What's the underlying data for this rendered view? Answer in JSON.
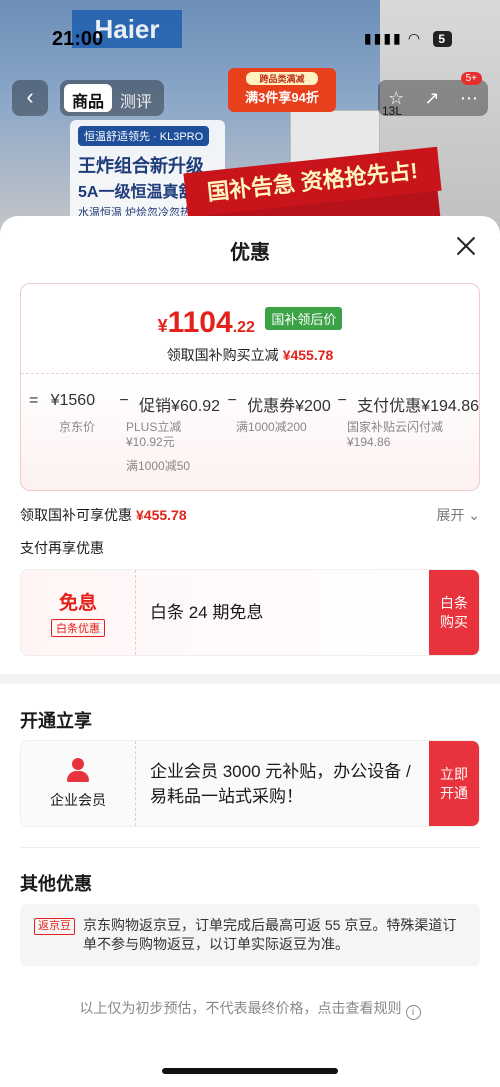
{
  "status_bar": {
    "time": "21:00",
    "signal": "▮▮▮▮",
    "wifi": "◠",
    "battery": "5"
  },
  "background": {
    "brand": "Haier",
    "badge_small": "跨品类满减",
    "badge_main": "满3件享94折",
    "card_tag": "恒温舒适领先 · KL3PRO",
    "card_line1": "王炸组合新升级",
    "card_line2": "5A一级恒温真舒适",
    "card_line3": "水温恒温 炉烩忽冷忽热",
    "banner": "国补告急 资格抢先占!",
    "capacity": "13L"
  },
  "navbar": {
    "back_icon": "‹",
    "tabs": [
      "商品",
      "测评"
    ],
    "badge_count": "5+"
  },
  "sheet": {
    "title": "优惠",
    "price": {
      "yen": "¥",
      "integer": "1104",
      "decimal": ".22",
      "tag": "国补领后价"
    },
    "claim": {
      "label": "领取国补购买立减",
      "amount": "¥455.78"
    },
    "formula": {
      "items": [
        {
          "op": "=",
          "label": "¥1560",
          "sub": "京东价"
        },
        {
          "op": "−",
          "label": "促销¥60.92",
          "sub": "PLUS立减\n¥10.92元",
          "sub2": "满1000减50"
        },
        {
          "op": "−",
          "label": "优惠券¥200",
          "sub": "满1000减200"
        },
        {
          "op": "−",
          "label": "支付优惠¥194.86",
          "sub": "国家补贴云闪付减\n¥194.86"
        }
      ]
    },
    "subsidy_line": {
      "label": "领取国补可享优惠",
      "amount": "¥455.78",
      "expand": "展开 ⌄"
    },
    "pay_again": "支付再享优惠",
    "baitiao_card": {
      "title": "免息",
      "tag": "白条优惠",
      "text": "白条 24 期免息",
      "button": "白条\n购买"
    },
    "open_section_title": "开通立享",
    "enterprise_card": {
      "label": "企业会员",
      "text": "企业会员 3000 元补贴，办公设备 / 易耗品一站式采购！",
      "button": "立即\n开通"
    },
    "other_title": "其他优惠",
    "return_card": {
      "tag": "返京豆",
      "text": "京东购物返京豆，订单完成后最高可返 55 京豆。特殊渠道订单不参与购物返豆，以订单实际返豆为准。"
    },
    "footnote": "以上仅为初步预估，不代表最终价格，点击查看规则",
    "info_icon": "i"
  },
  "colors": {
    "accent_red": "#e3231b",
    "button_red": "#e8323c",
    "gov_green": "#3aa346"
  }
}
